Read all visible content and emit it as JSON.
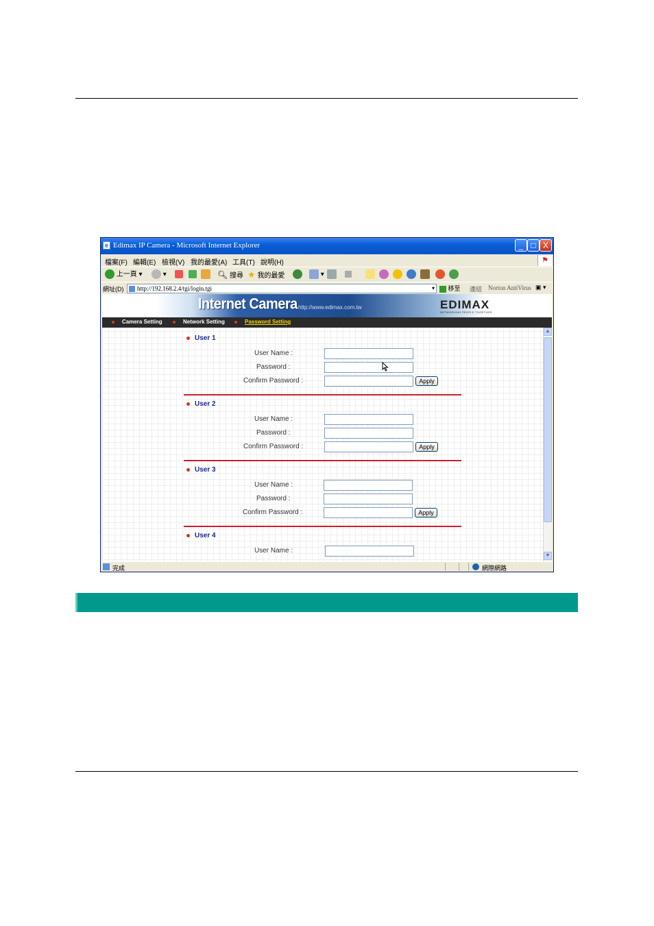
{
  "window": {
    "title": "Edimax IP Camera - Microsoft Internet Explorer",
    "minimize": "_",
    "maximize": "□",
    "close": "X"
  },
  "menubar": {
    "items": [
      "檔案(F)",
      "編輯(E)",
      "檢視(V)",
      "我的最愛(A)",
      "工具(T)",
      "說明(H)"
    ]
  },
  "toolbar": {
    "back_label": "上一頁",
    "search_label": "搜尋",
    "favorites_label": "我的最愛"
  },
  "addressbar": {
    "label": "網址(D)",
    "url": "http://192.168.2.4/tgi/login.tgi",
    "go_label": "移至",
    "links_label": "連結",
    "antivirus_label": "Norton AntiVirus"
  },
  "banner": {
    "product": "Internet Camera",
    "site": "http://www.edimax.com.tw",
    "brand": "EDIMAX",
    "tagline": "NETWORKING PEOPLE TOGETHER"
  },
  "nav": {
    "items": [
      {
        "label": "Camera Setting"
      },
      {
        "label": "Network Setting"
      },
      {
        "label": "Password Setting"
      }
    ]
  },
  "users": [
    {
      "title": "User 1",
      "username_label": "User Name :",
      "password_label": "Password :",
      "confirm_label": "Confirm Password :",
      "apply_label": "Apply"
    },
    {
      "title": "User 2",
      "username_label": "User Name :",
      "password_label": "Password :",
      "confirm_label": "Confirm Password :",
      "apply_label": "Apply"
    },
    {
      "title": "User 3",
      "username_label": "User Name :",
      "password_label": "Password :",
      "confirm_label": "Confirm Password :",
      "apply_label": "Apply"
    },
    {
      "title": "User 4",
      "username_label": "User Name :"
    }
  ],
  "statusbar": {
    "status": "完成",
    "zone": "網際網路"
  },
  "colors": {
    "section_bar": "#009a8d",
    "separator": "#c8202a",
    "user_heading": "#1c2a8f"
  }
}
